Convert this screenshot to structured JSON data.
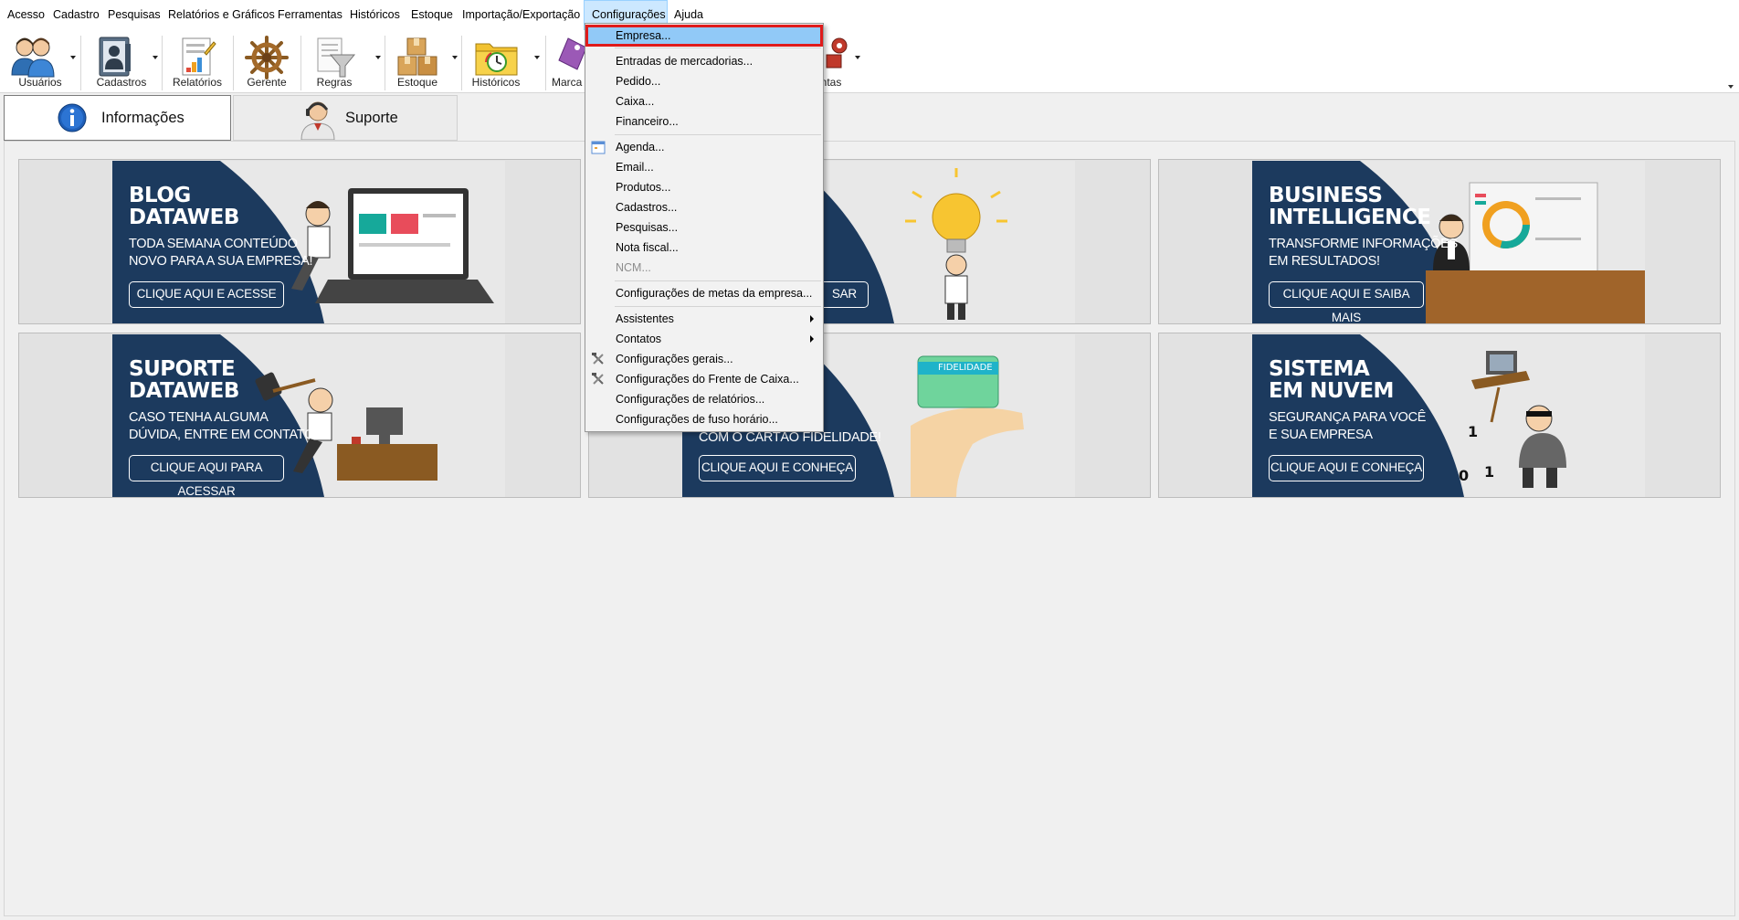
{
  "menubar": {
    "items": [
      "Acesso",
      "Cadastro",
      "Pesquisas",
      "Relatórios e Gráficos",
      "Ferramentas",
      "Históricos",
      "Estoque",
      "Importação/Exportação",
      "Configurações",
      "Ajuda"
    ],
    "open_item": "Configurações"
  },
  "toolbar": {
    "buttons": [
      {
        "label": "Usuários",
        "icon": "users-icon"
      },
      {
        "label": "Cadastros",
        "icon": "contact-card-icon"
      },
      {
        "label": "Relatórios",
        "icon": "report-icon"
      },
      {
        "label": "Gerente",
        "icon": "ship-wheel-icon"
      },
      {
        "label": "Regras",
        "icon": "rules-funnel-icon"
      },
      {
        "label": "Estoque",
        "icon": "boxes-icon"
      },
      {
        "label": "Históricos",
        "icon": "history-folder-icon"
      },
      {
        "label": "Marca",
        "icon": "tag-icon"
      },
      {
        "label": "mentas",
        "icon": "tools-gear-icon"
      }
    ]
  },
  "tabs": [
    {
      "label": "Informações",
      "icon": "info-icon",
      "active": true
    },
    {
      "label": "Suporte",
      "icon": "support-agent-icon",
      "active": false
    }
  ],
  "banners": [
    {
      "title1": "BLOG",
      "title2": "DATAWEB",
      "sub1": "TODA SEMANA CONTEÚDO",
      "sub2": "NOVO PARA A SUA EMPRESA!",
      "button": "CLIQUE AQUI E ACESSE"
    },
    {
      "title1": "",
      "title2": "",
      "sub1": "",
      "sub2": "",
      "button": "SAR"
    },
    {
      "title1": "BUSINESS",
      "title2": "INTELLIGENCE",
      "sub1": "TRANSFORME INFORMAÇÕES",
      "sub2": "EM RESULTADOS!",
      "button": "CLIQUE AQUI E SAIBA MAIS"
    },
    {
      "title1": "SUPORTE",
      "title2": "DATAWEB",
      "sub1": "CASO TENHA ALGUMA",
      "sub2": "DÚVIDA, ENTRE EM CONTATO!",
      "button": "CLIQUE AQUI PARA ACESSAR"
    },
    {
      "title1": "",
      "title2": "",
      "sub1": "",
      "sub2": "COM O CARTÃO FIDELIDADE!",
      "button": "CLIQUE AQUI E CONHEÇA",
      "card_label": "FIDELIDADE"
    },
    {
      "title1": "SISTEMA",
      "title2": "EM NUVEM",
      "sub1": "SEGURANÇA PARA VOCÊ",
      "sub2": "E SUA EMPRESA",
      "button": "CLIQUE AQUI E CONHEÇA"
    }
  ],
  "dropdown": {
    "items": [
      {
        "label": "Empresa...",
        "highlighted": true
      },
      {
        "label": "Entradas de mercadorias..."
      },
      {
        "label": "Pedido..."
      },
      {
        "label": "Caixa..."
      },
      {
        "label": "Financeiro..."
      },
      {
        "label": "Agenda...",
        "icon": "calendar-icon"
      },
      {
        "label": "Email..."
      },
      {
        "label": "Produtos..."
      },
      {
        "label": "Cadastros..."
      },
      {
        "label": "Pesquisas..."
      },
      {
        "label": "Nota fiscal..."
      },
      {
        "label": "NCM...",
        "disabled": true
      },
      {
        "label": "Configurações de metas da empresa..."
      },
      {
        "label": "Assistentes",
        "submenu": true
      },
      {
        "label": "Contatos",
        "submenu": true
      },
      {
        "label": "Configurações gerais...",
        "icon": "tools-icon"
      },
      {
        "label": "Configurações do Frente de Caixa...",
        "icon": "tools-icon"
      },
      {
        "label": "Configurações de relatórios..."
      },
      {
        "label": "Configurações de fuso horário..."
      }
    ]
  },
  "colors": {
    "banner_navy": "#1c3a5e",
    "highlight": "#91c9f7",
    "highlight_border": "#e01b1b",
    "menu_open_bg": "#cce8ff"
  }
}
